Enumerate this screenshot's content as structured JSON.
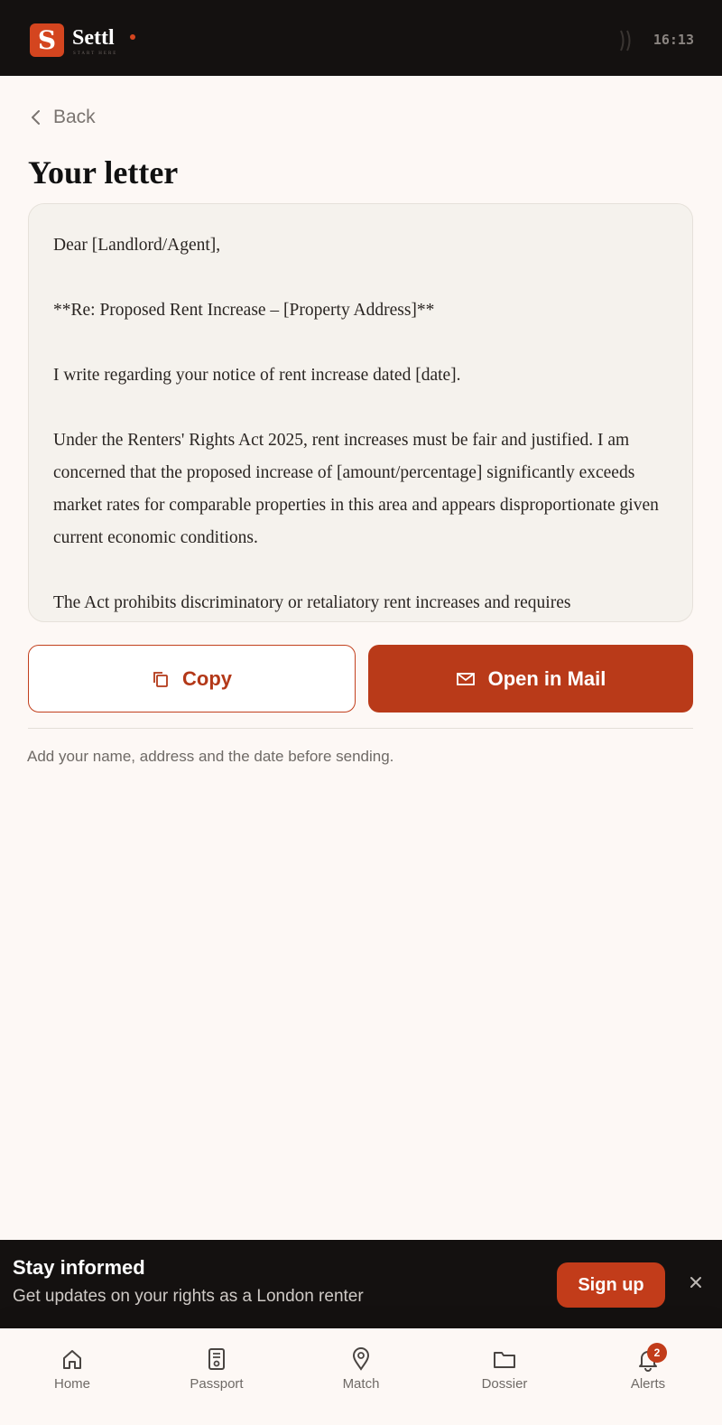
{
  "app": {
    "brand": "Settl",
    "tagline": "START HERE",
    "logo_letter": "S",
    "time": "16:13",
    "accent_color": "#c23c1a"
  },
  "nav": {
    "back_label": "Back"
  },
  "page": {
    "title": "Your letter"
  },
  "letter": {
    "paragraphs": [
      "Dear [Landlord/Agent],",
      "**Re: Proposed Rent Increase – [Property Address]**",
      "I write regarding your notice of rent increase dated [date].",
      "Under the Renters' Rights Act 2025, rent increases must be fair and justified. I am concerned that the proposed increase of [amount/percentage] significantly exceeds market rates for comparable properties in this area and appears disproportionate given current economic conditions.",
      "The Act prohibits discriminatory or retaliatory rent increases and requires"
    ]
  },
  "actions": {
    "copy_label": "Copy",
    "mail_label": "Open in Mail"
  },
  "hint": "Add your name, address and the date before sending.",
  "banner": {
    "title": "Stay informed",
    "subtitle": "Get updates on your rights as a London renter",
    "cta": "Sign up",
    "close_icon": "×"
  },
  "tabs": [
    {
      "label": "Home",
      "icon": "home-icon"
    },
    {
      "label": "Passport",
      "icon": "passport-icon"
    },
    {
      "label": "Match",
      "icon": "location-pin-icon"
    },
    {
      "label": "Dossier",
      "icon": "folder-icon"
    },
    {
      "label": "Alerts",
      "icon": "bell-icon",
      "badge": "2"
    }
  ]
}
